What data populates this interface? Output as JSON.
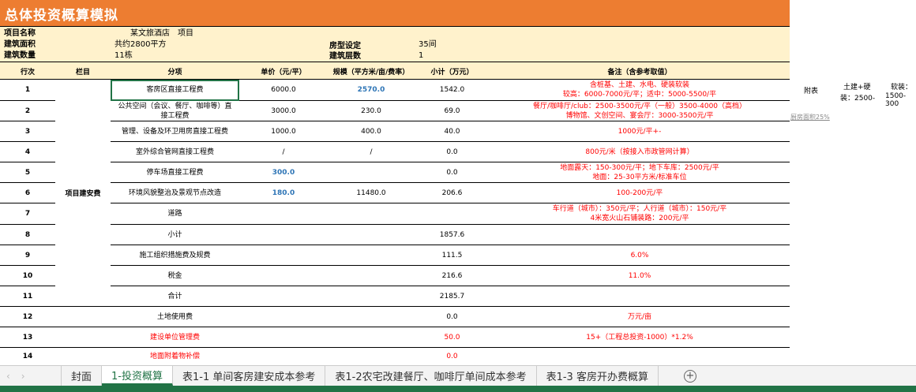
{
  "title": "总体投资概算模拟",
  "info": {
    "name_label": "项目名称",
    "name_value": "某文旅酒店　项目",
    "area_label": "建筑面积",
    "area_value": "共约2800平方",
    "count_label": "建筑数量",
    "count_value": "11栋",
    "room_label": "房型设定",
    "room_value": "35间",
    "floors_label": "建筑层数",
    "floors_value": "1"
  },
  "headers": [
    "行次",
    "栏目",
    "分项",
    "单价（元/平）",
    "规模（平方米/亩/费率）",
    "小计（万元）",
    "备注（含参考取值）"
  ],
  "category": "项目建安费",
  "rows": [
    {
      "no": "1",
      "item": "客房区直接工程费",
      "price": "6000.0",
      "scale": "2570.0",
      "subtotal": "1542.0",
      "note": [
        "含桩基、土建、水电、硬装软装",
        "较高：6000-7000元/平；适中：5000-5500/平"
      ],
      "scale_blue": true
    },
    {
      "no": "2",
      "item": "公共空间（会议、餐厅、咖啡等）直接工程费",
      "price": "3000.0",
      "scale": "230.0",
      "subtotal": "69.0",
      "note": [
        "餐厅/咖啡厅/club：2500-3500元/平（一般）3500-4000（高档）",
        "博物馆、文创空间、宴会厅：3000-3500元/平"
      ]
    },
    {
      "no": "3",
      "item": "管理、设备及环卫用房直接工程费",
      "price": "1000.0",
      "scale": "400.0",
      "subtotal": "40.0",
      "note": [
        "1000元/平+-"
      ]
    },
    {
      "no": "4",
      "item": "室外综合管网直接工程费",
      "price": "/",
      "scale": "/",
      "subtotal": "0.0",
      "note": [
        "800元/米（按接入市政管网计算）"
      ]
    },
    {
      "no": "5",
      "item": "停车场直接工程费",
      "price": "300.0",
      "scale": "",
      "subtotal": "0.0",
      "note": [
        "地面露天：150-300元/平；地下车库：2500元/平",
        "地面：25-30平方米/标准车位"
      ],
      "price_blue": true
    },
    {
      "no": "6",
      "item": "环境风貌整治及景观节点改造",
      "price": "180.0",
      "scale": "11480.0",
      "subtotal": "206.6",
      "note": [
        "100-200元/平"
      ],
      "price_blue": true
    },
    {
      "no": "7",
      "item": "道路",
      "price": "",
      "scale": "",
      "subtotal": "",
      "note": [
        "车行道（城市）：350元/平；人行道（城市）：150元/平",
        "4米宽火山石铺装路：200元/平"
      ]
    },
    {
      "no": "8",
      "item": "小计",
      "price": "",
      "scale": "",
      "subtotal": "1857.6",
      "note": []
    },
    {
      "no": "9",
      "item": "施工组织措施费及规费",
      "price": "",
      "scale": "",
      "subtotal": "111.5",
      "note": [
        "6.0%"
      ]
    },
    {
      "no": "10",
      "item": "税金",
      "price": "",
      "scale": "",
      "subtotal": "216.6",
      "note": [
        "11.0%"
      ]
    },
    {
      "no": "11",
      "item": "合计",
      "price": "",
      "scale": "",
      "subtotal": "2185.7",
      "note": []
    },
    {
      "no": "12",
      "item": "土地使用费",
      "price": "",
      "scale": "",
      "subtotal": "0.0",
      "note": [
        "万元/亩"
      ]
    },
    {
      "no": "13",
      "item": "建设单位管理费",
      "price": "",
      "scale": "",
      "subtotal": "50.0",
      "note": [
        "15+（工程总投资-1000）*1.2%"
      ],
      "red": true
    },
    {
      "no": "14",
      "item": "地面附着物补偿",
      "price": "",
      "scale": "",
      "subtotal": "0.0",
      "note": [],
      "red": true
    }
  ],
  "side": {
    "appendix": "附表",
    "col1a": "土建+硬",
    "col1b": "装：2500-",
    "col2a": "软装：",
    "col2b": "1500-300",
    "kitchen": "厨房面积25%"
  },
  "tabs": [
    "封面",
    "1-投资概算",
    "表1-1 单间客房建安成本参考",
    "表1-2农宅改建餐厅、咖啡厅单间成本参考",
    "表1-3 客房开办费概算"
  ],
  "active_tab": 1
}
